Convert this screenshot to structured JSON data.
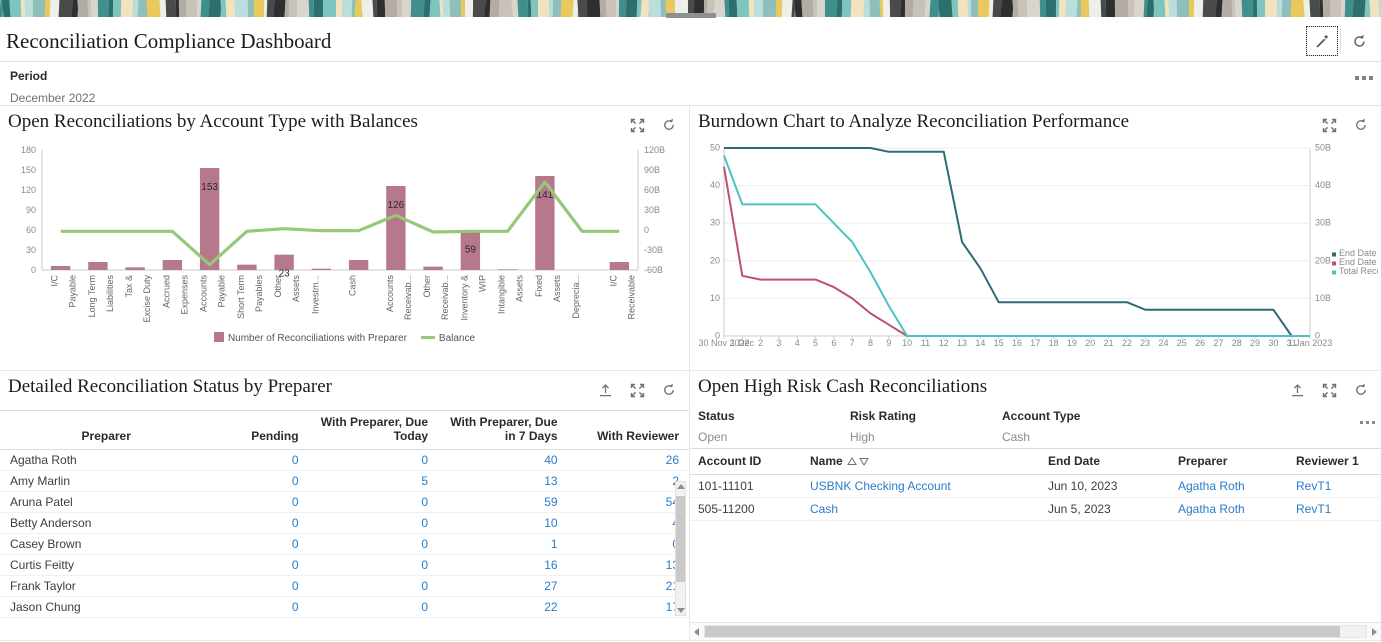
{
  "header": {
    "title": "Reconciliation Compliance Dashboard",
    "edit_icon": "pencil-icon",
    "refresh_icon": "refresh-icon"
  },
  "period": {
    "label": "Period",
    "value": "December 2022",
    "menu_icon": "overflow-menu-icon"
  },
  "panels": {
    "bar": {
      "title": "Open Reconciliations by Account Type with Balances",
      "expand_icon": "expand-icon",
      "refresh_icon": "refresh-icon"
    },
    "burndown": {
      "title": "Burndown Chart to Analyze Reconciliation Performance",
      "expand_icon": "expand-icon",
      "refresh_icon": "refresh-icon"
    },
    "preparer": {
      "title": "Detailed Reconciliation Status by Preparer",
      "export_icon": "export-icon",
      "expand_icon": "expand-icon",
      "refresh_icon": "refresh-icon"
    },
    "highrisk": {
      "title": "Open High Risk Cash Reconciliations",
      "export_icon": "export-icon",
      "expand_icon": "expand-icon",
      "refresh_icon": "refresh-icon",
      "menu_icon": "overflow-menu-icon"
    }
  },
  "chart_data": [
    {
      "type": "bar",
      "title": "Open Reconciliations by Account Type with Balances",
      "xlabel": "",
      "ylabel": "",
      "ylim": [
        0,
        180
      ],
      "y_ticks": [
        "0",
        "30",
        "60",
        "90",
        "120",
        "150",
        "180"
      ],
      "y2lim": [
        -60000000000,
        120000000000
      ],
      "y2_ticks": [
        "-60B",
        "-30B",
        "0",
        "30B",
        "60B",
        "90B",
        "120B"
      ],
      "grid": false,
      "legend_position": "bottom",
      "categories": [
        "I/C Payable",
        "Long Term Liabilities",
        "Tax & Excise Duty",
        "Accrued Expenses",
        "Accounts Payable",
        "Short Term Payables",
        "Other Assets",
        "Investm...",
        "Cash",
        "Accounts Receivab...",
        "Other Receivab...",
        "Inventory & WIP",
        "Intangible Assets",
        "Fixed Assets",
        "Deprecia...",
        "I/C Receivable"
      ],
      "series": [
        {
          "name": "Number of Reconciliations with Preparer",
          "type": "bar",
          "color": "#b5788c",
          "values": [
            6,
            12,
            4,
            15,
            153,
            8,
            23,
            2,
            15,
            126,
            5,
            59,
            1,
            141,
            0,
            12
          ],
          "labels": [
            "",
            "",
            "",
            "",
            "153",
            "",
            "23",
            "",
            "",
            "126",
            "",
            "59",
            "",
            "141",
            "",
            ""
          ]
        },
        {
          "name": "Balance",
          "type": "line",
          "color": "#96c878",
          "axis": "y2",
          "values": [
            -2000000000,
            -2000000000,
            -2000000000,
            -2000000000,
            -52000000000,
            -2000000000,
            2000000000,
            -1000000000,
            -1000000000,
            22000000000,
            -3000000000,
            -2000000000,
            -2000000000,
            72000000000,
            -2000000000,
            -2000000000
          ]
        }
      ]
    },
    {
      "type": "line",
      "title": "Burndown Chart to Analyze Reconciliation Performance",
      "xlabel": "",
      "ylabel": "",
      "ylim": [
        0,
        50
      ],
      "y_ticks": [
        "0",
        "10",
        "20",
        "30",
        "40",
        "50"
      ],
      "y2_ticks": [
        "0",
        "10B",
        "20B",
        "30B",
        "40B",
        "50B"
      ],
      "grid": true,
      "legend_position": "right",
      "x": [
        "30 Nov 2022",
        "1 Dec",
        "2",
        "3",
        "4",
        "5",
        "6",
        "7",
        "8",
        "9",
        "10",
        "11",
        "12",
        "13",
        "14",
        "15",
        "16",
        "17",
        "18",
        "19",
        "20",
        "21",
        "22",
        "23",
        "24",
        "25",
        "26",
        "27",
        "28",
        "29",
        "30",
        "31",
        "1 Jan 2023"
      ],
      "series": [
        {
          "name": "End Date",
          "color": "#2e6b77",
          "values": [
            50,
            50,
            50,
            50,
            50,
            50,
            50,
            50,
            50,
            49,
            49,
            49,
            49,
            25,
            18,
            9,
            9,
            9,
            9,
            9,
            9,
            9,
            9,
            7,
            7,
            7,
            7,
            7,
            7,
            7,
            7,
            0,
            0
          ]
        },
        {
          "name": "End Date (Actual)",
          "color": "#c04f6d",
          "values": [
            45,
            16,
            15,
            15,
            15,
            15,
            13,
            10,
            6,
            3,
            0,
            0,
            0,
            0,
            0,
            0,
            0,
            0,
            0,
            0,
            0,
            0,
            0,
            0,
            0,
            0,
            0,
            0,
            0,
            0,
            0,
            0,
            0
          ]
        },
        {
          "name": "Total Reconciled Balance",
          "color": "#4cc2c4",
          "values": [
            48,
            35,
            35,
            35,
            35,
            35,
            30,
            25,
            17,
            8,
            0,
            0,
            0,
            0,
            0,
            0,
            0,
            0,
            0,
            0,
            0,
            0,
            0,
            0,
            0,
            0,
            0,
            0,
            0,
            0,
            0,
            0,
            0
          ]
        }
      ]
    }
  ],
  "preparer_table": {
    "columns": [
      "Preparer",
      "Pending",
      "With Preparer, Due Today",
      "With Preparer, Due in 7 Days",
      "With Reviewer"
    ],
    "rows": [
      {
        "preparer": "Agatha Roth",
        "pending": "0",
        "due_today": "0",
        "due_7_days": "40",
        "with_reviewer": "26"
      },
      {
        "preparer": "Amy Marlin",
        "pending": "0",
        "due_today": "5",
        "due_7_days": "13",
        "with_reviewer": "2"
      },
      {
        "preparer": "Aruna Patel",
        "pending": "0",
        "due_today": "0",
        "due_7_days": "59",
        "with_reviewer": "54"
      },
      {
        "preparer": "Betty Anderson",
        "pending": "0",
        "due_today": "0",
        "due_7_days": "10",
        "with_reviewer": "4"
      },
      {
        "preparer": "Casey Brown",
        "pending": "0",
        "due_today": "0",
        "due_7_days": "1",
        "with_reviewer": "0"
      },
      {
        "preparer": "Curtis Feitty",
        "pending": "0",
        "due_today": "0",
        "due_7_days": "16",
        "with_reviewer": "13"
      },
      {
        "preparer": "Frank Taylor",
        "pending": "0",
        "due_today": "0",
        "due_7_days": "27",
        "with_reviewer": "21"
      },
      {
        "preparer": "Jason Chung",
        "pending": "0",
        "due_today": "0",
        "due_7_days": "22",
        "with_reviewer": "17"
      }
    ]
  },
  "highrisk": {
    "filters": [
      {
        "label": "Status",
        "value": "Open"
      },
      {
        "label": "Risk Rating",
        "value": "High"
      },
      {
        "label": "Account Type",
        "value": "Cash"
      }
    ],
    "columns": [
      "Account ID",
      "Name",
      "End Date",
      "Preparer",
      "Reviewer 1"
    ],
    "rows": [
      {
        "account_id": "101-11101",
        "name": "USBNK Checking Account",
        "end_date": "Jun 10, 2023",
        "preparer": "Agatha Roth",
        "reviewer": "RevT1"
      },
      {
        "account_id": "505-11200",
        "name": "Cash",
        "end_date": "Jun 5, 2023",
        "preparer": "Agatha Roth",
        "reviewer": "RevT1"
      }
    ]
  },
  "colors": {
    "bar": "#b5788c",
    "balance_line": "#96c878",
    "link": "#2a7cc7",
    "end_date": "#2e6b77",
    "end_date_actual": "#c04f6d",
    "total_reconciled": "#4cc2c4"
  }
}
